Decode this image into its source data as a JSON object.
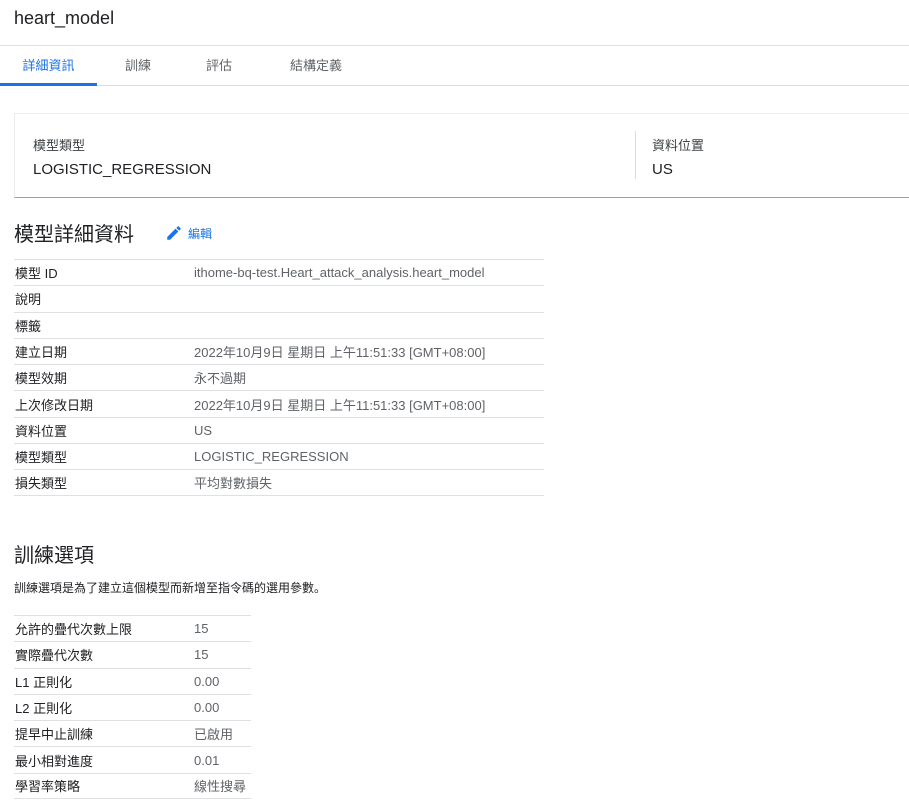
{
  "header": {
    "title": "heart_model"
  },
  "tabs": [
    {
      "label": "詳細資訊",
      "active": true
    },
    {
      "label": "訓練",
      "active": false
    },
    {
      "label": "評估",
      "active": false
    },
    {
      "label": "結構定義",
      "active": false
    }
  ],
  "summary": {
    "model_type_label": "模型類型",
    "model_type_value": "LOGISTIC_REGRESSION",
    "data_location_label": "資料位置",
    "data_location_value": "US"
  },
  "model_details": {
    "title": "模型詳細資料",
    "edit_label": "編輯",
    "edit_icon": "pencil-icon",
    "rows": [
      {
        "key": "模型 ID",
        "value": "ithome-bq-test.Heart_attack_analysis.heart_model"
      },
      {
        "key": "說明",
        "value": ""
      },
      {
        "key": "標籤",
        "value": ""
      },
      {
        "key": "建立日期",
        "value": "2022年10月9日 星期日 上午11:51:33 [GMT+08:00]"
      },
      {
        "key": "模型效期",
        "value": "永不過期"
      },
      {
        "key": "上次修改日期",
        "value": "2022年10月9日 星期日 上午11:51:33 [GMT+08:00]"
      },
      {
        "key": "資料位置",
        "value": "US"
      },
      {
        "key": "模型類型",
        "value": "LOGISTIC_REGRESSION"
      },
      {
        "key": "損失類型",
        "value": "平均對數損失"
      }
    ]
  },
  "training_options": {
    "title": "訓練選項",
    "description": "訓練選項是為了建立這個模型而新增至指令碼的選用參數。",
    "rows": [
      {
        "key": "允許的疊代次數上限",
        "value": "15"
      },
      {
        "key": "實際疊代次數",
        "value": "15"
      },
      {
        "key": "L1 正則化",
        "value": "0.00"
      },
      {
        "key": "L2 正則化",
        "value": "0.00"
      },
      {
        "key": "提早中止訓練",
        "value": "已啟用"
      },
      {
        "key": "最小相對進度",
        "value": "0.01"
      },
      {
        "key": "學習率策略",
        "value": "線性搜尋"
      }
    ]
  },
  "colors": {
    "accent": "#1a73e8",
    "text": "#202124",
    "muted": "#5f6368",
    "divider": "#e0e0e0"
  }
}
